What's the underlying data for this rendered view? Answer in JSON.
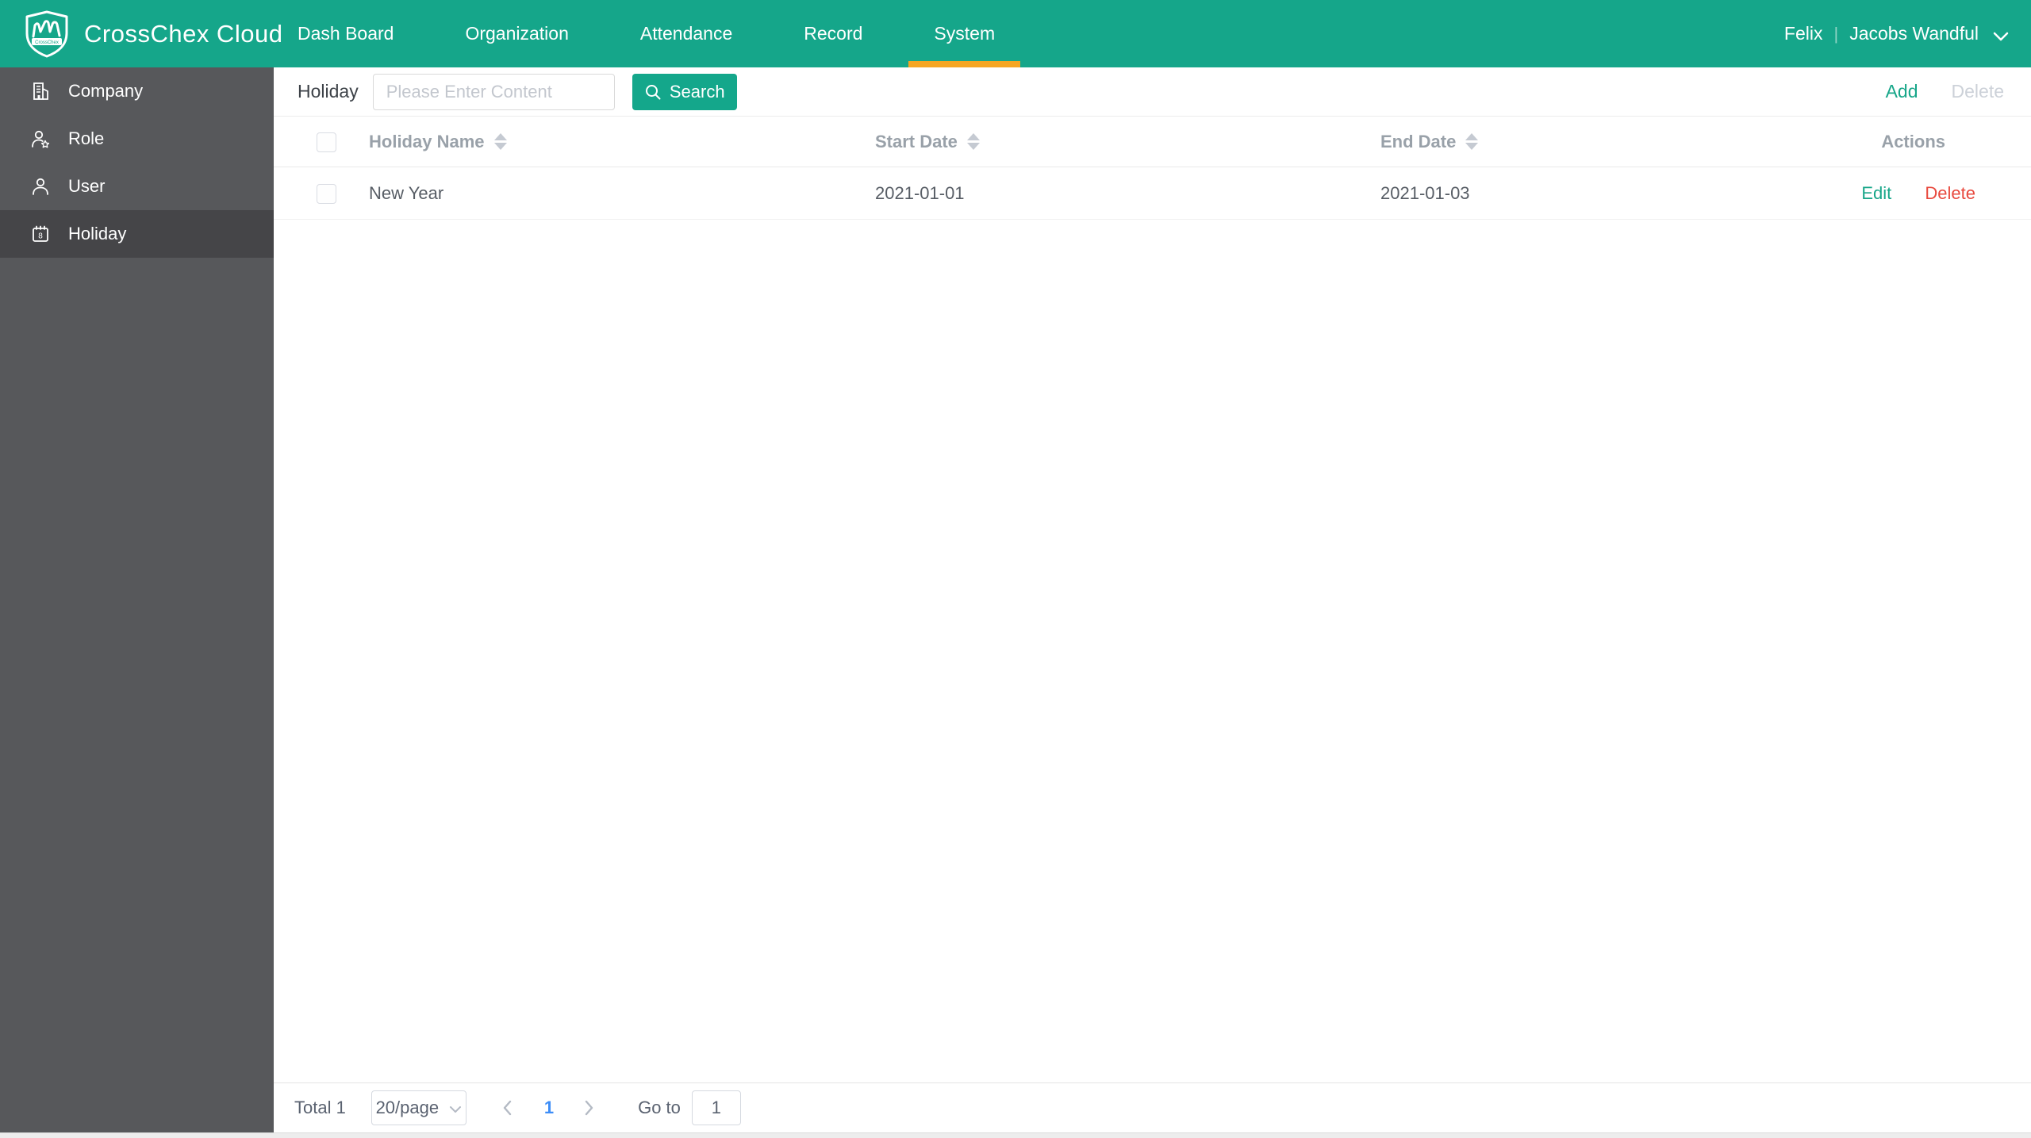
{
  "header": {
    "brand": "CrossChex Cloud",
    "nav": [
      {
        "label": "Dash Board",
        "active": false
      },
      {
        "label": "Organization",
        "active": false
      },
      {
        "label": "Attendance",
        "active": false
      },
      {
        "label": "Record",
        "active": false
      },
      {
        "label": "System",
        "active": true
      }
    ],
    "user": {
      "company": "Felix",
      "separator": "|",
      "name": "Jacobs Wandful",
      "dropdown_icon": "chevron-down-icon"
    },
    "logo_icon": "shield-logo-icon"
  },
  "sidebar": {
    "items": [
      {
        "label": "Company",
        "icon": "building-icon",
        "active": false
      },
      {
        "label": "Role",
        "icon": "person-star-icon",
        "active": false
      },
      {
        "label": "User",
        "icon": "person-icon",
        "active": false
      },
      {
        "label": "Holiday",
        "icon": "calendar-icon",
        "active": true
      }
    ]
  },
  "toolbar": {
    "filter_label": "Holiday",
    "search_placeholder": "Please Enter Content",
    "search_value": "",
    "search_button": "Search",
    "search_icon": "magnifier-icon",
    "add_button": "Add",
    "delete_button": "Delete"
  },
  "table": {
    "columns": [
      "Holiday Name",
      "Start Date",
      "End Date",
      "Actions"
    ],
    "sortable_columns": [
      "Holiday Name",
      "Start Date",
      "End Date"
    ],
    "rows": [
      {
        "holiday_name": "New Year",
        "start_date": "2021-01-01",
        "end_date": "2021-01-03",
        "actions": [
          "Edit",
          "Delete"
        ]
      }
    ]
  },
  "pagination": {
    "total_label": "Total 1",
    "page_size": "20/page",
    "current_page": "1",
    "goto_label": "Go to",
    "goto_value": "1"
  },
  "colors": {
    "header_bg": "#15a68a",
    "active_tab_underline": "#f5a623",
    "sidebar_bg": "#57585b",
    "sidebar_active_bg": "#454548",
    "primary_button": "#14a78b",
    "link_green": "#17a689",
    "link_red": "#e8493e",
    "page_number_blue": "#3e8ef7",
    "disabled_gray": "#ccd1d8"
  }
}
